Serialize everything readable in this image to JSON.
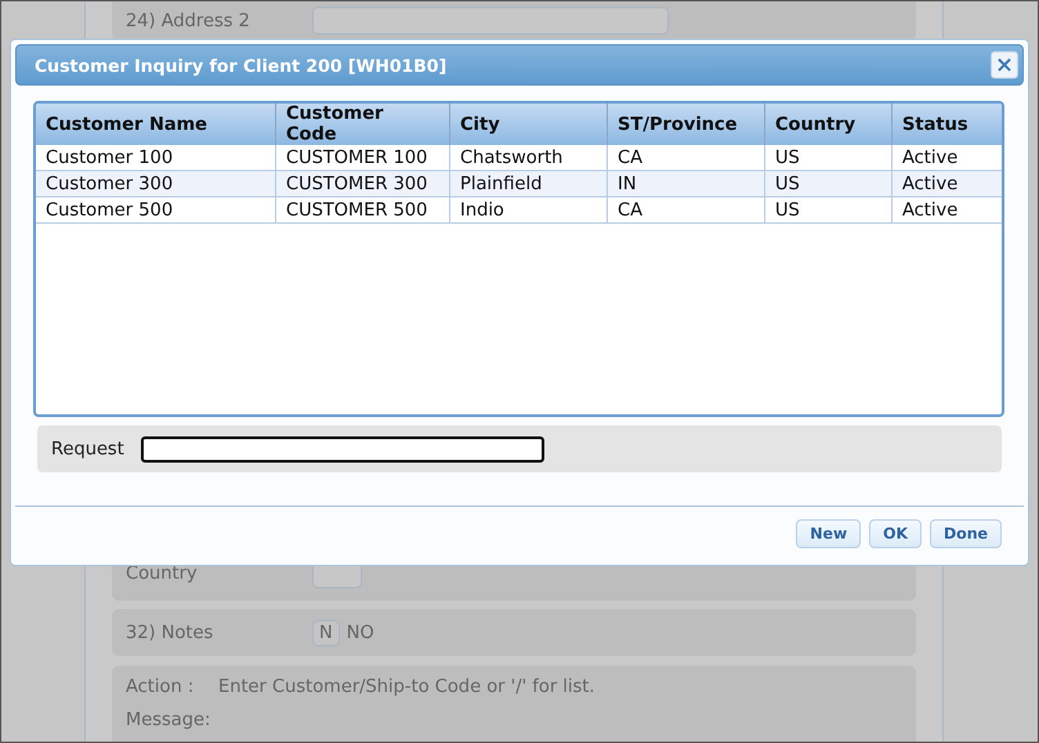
{
  "background_form": {
    "address_2": {
      "label": "24) Address 2"
    },
    "country": {
      "label": "Country"
    },
    "notes": {
      "label": "32) Notes",
      "value": "N",
      "description": "NO"
    },
    "action": {
      "label": "Action :",
      "text": "Enter Customer/Ship-to Code or '/' for list."
    },
    "message": {
      "label": "Message:"
    }
  },
  "dialog": {
    "title": "Customer Inquiry for Client 200 [WH01B0]",
    "close": "×",
    "table": {
      "columns": [
        "Customer Name",
        "Customer Code",
        "City",
        "ST/Province",
        "Country",
        "Status"
      ],
      "rows": [
        [
          "Customer 100",
          "CUSTOMER 100",
          "Chatsworth",
          "CA",
          "US",
          "Active"
        ],
        [
          "Customer 300",
          "CUSTOMER 300",
          "Plainfield",
          "IN",
          "US",
          "Active"
        ],
        [
          "Customer 500",
          "CUSTOMER 500",
          "Indio",
          "CA",
          "US",
          "Active"
        ]
      ]
    },
    "request": {
      "label": "Request"
    },
    "buttons": [
      "New",
      "OK",
      "Done"
    ]
  }
}
